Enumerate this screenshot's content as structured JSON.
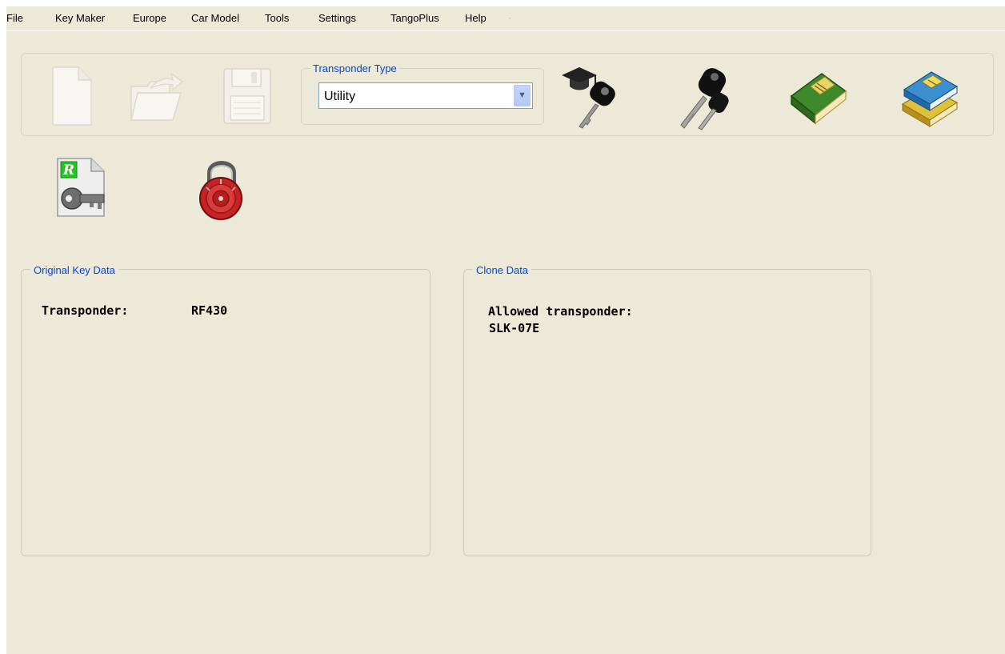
{
  "menu": [
    "File",
    "Key Maker",
    "Europe",
    "Car Model",
    "Tools",
    "Settings",
    "TangoPlus",
    "Help"
  ],
  "toolbar": {
    "icons": [
      "new-file-icon",
      "open-folder-icon",
      "save-disk-icon",
      "key-graduation-icon",
      "car-keys-icon",
      "green-book-icon",
      "books-stack-icon"
    ],
    "transponder_type": {
      "legend": "Transponder Type",
      "selected": "Utility"
    }
  },
  "row2": {
    "icons": [
      "read-key-file-icon",
      "padlock-icon"
    ],
    "read_badge": "R"
  },
  "original_key": {
    "legend": "Original Key Data",
    "transponder_label": "Transponder:",
    "transponder_value": "RF430"
  },
  "clone": {
    "legend": "Clone Data",
    "allowed_label": "Allowed transponder:",
    "allowed_value": "SLK-07E"
  },
  "colors": {
    "background": "#ece9d8",
    "legend_text": "#0046d5"
  }
}
